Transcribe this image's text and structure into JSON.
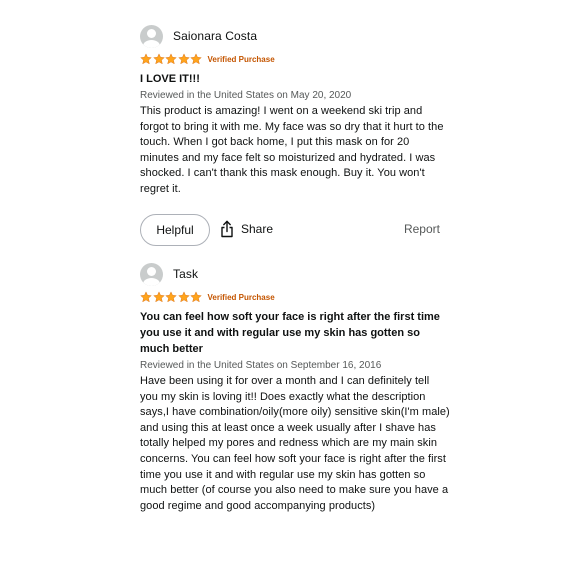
{
  "colors": {
    "star": "#ffa41c",
    "verified": "#c45500",
    "meta": "#565959",
    "text": "#0f1111",
    "avatar": "#c9cccc"
  },
  "reviews": [
    {
      "reviewer": "Saionara Costa",
      "rating": 5,
      "verified_label": "Verified Purchase",
      "title": "I LOVE IT!!!",
      "date": "Reviewed in the United States on May 20, 2020",
      "body": "This product is amazing! I went on a weekend ski trip and forgot to bring it with me. My face was so dry that it hurt to the touch. When I got back home, I put this mask on for 20 minutes and my face felt so moisturized and hydrated. I was shocked. I can't thank this mask enough. Buy it. You won't regret it.",
      "helpful_label": "Helpful",
      "share_label": "Share",
      "report_label": "Report"
    },
    {
      "reviewer": "Task",
      "rating": 5,
      "verified_label": "Verified Purchase",
      "title": "You can feel how soft your face is right after the first time you use it and with regular use my skin has gotten so much better",
      "date": "Reviewed in the United States on September 16, 2016",
      "body": "Have been using it for over a month and I can definitely tell you my skin is loving it!! Does exactly what the description says,I have combination/oily(more oily) sensitive skin(I'm male) and using this at least once a week usually after I shave has totally helped my pores and redness which are my main skin concerns. You can feel how soft your face is right after the first time you use it and with regular use my skin has gotten so much better (of course you also need to make sure you have a good regime and good accompanying products)"
    }
  ]
}
